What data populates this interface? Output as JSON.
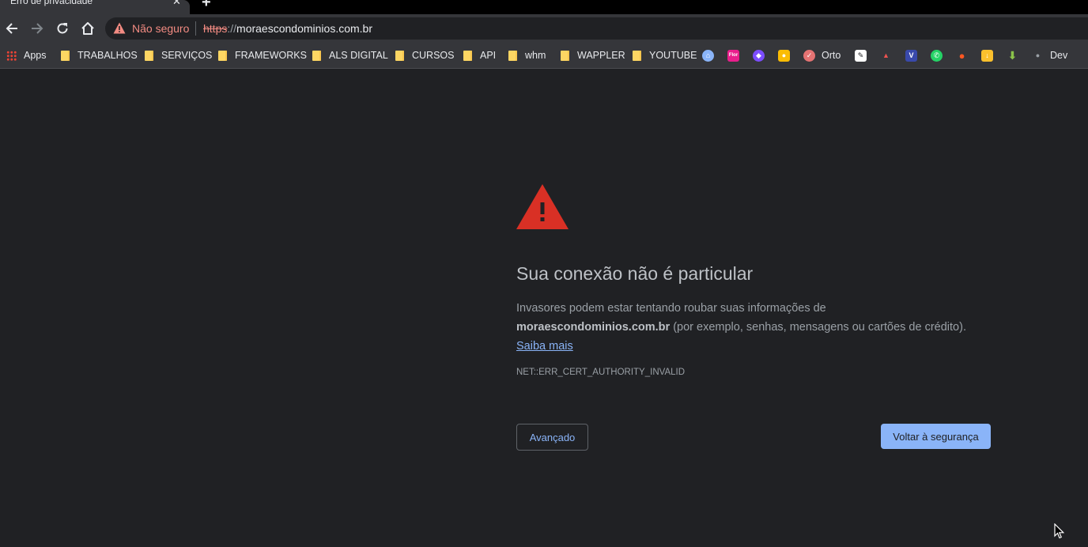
{
  "tab": {
    "title": "Erro de privacidade",
    "close_glyph": "✕",
    "new_tab_glyph": "+"
  },
  "omnibox": {
    "security_label": "Não seguro",
    "url_scheme": "https",
    "url_separator": "://",
    "url_host": "moraescondominios.com.br"
  },
  "bookmarks": {
    "apps_label": "Apps",
    "folders": [
      "TRABALHOS",
      "SERVIÇOS",
      "FRAMEWORKS",
      "ALS DIGITAL",
      "CURSOS",
      "API",
      "whm",
      "WAPPLER",
      "YOUTUBE"
    ],
    "orto_label": "Orto",
    "dev_label": "Dev",
    "favicon_flor": "Flor",
    "favicon_v": "V"
  },
  "interstitial": {
    "heading": "Sua conexão não é particular",
    "explain_line1": "Invasores podem estar tentando roubar suas informações de",
    "domain": "moraescondominios.com.br",
    "explain_line2": " (por exemplo, senhas, mensagens ou cartões de crédito).",
    "learn_more": "Saiba mais",
    "error_code": "NET::ERR_CERT_AUTHORITY_INVALID",
    "advanced_button": "Avançado",
    "back_button": "Voltar à segurança"
  },
  "colors": {
    "background": "#202124",
    "toolbar": "#35363a",
    "warning_red": "#d93025",
    "link_blue": "#8ab4f8",
    "not_secure_red": "#f28b82"
  }
}
